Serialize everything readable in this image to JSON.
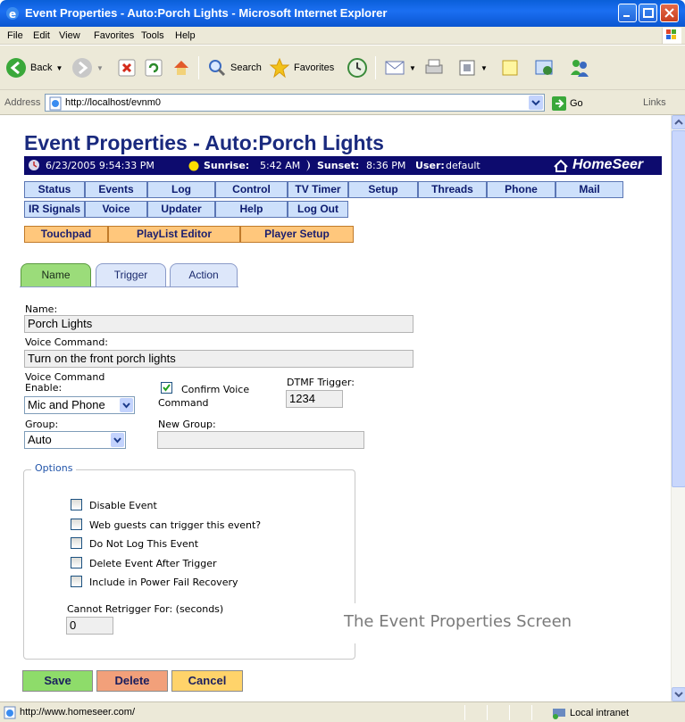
{
  "window": {
    "title": "Event Properties - Auto:Porch Lights - Microsoft Internet Explorer"
  },
  "menu": [
    "File",
    "Edit",
    "View",
    "Favorites",
    "Tools",
    "Help"
  ],
  "toolbar": {
    "back_label": "Back",
    "search_label": "Search",
    "favorites_label": "Favorites"
  },
  "address": {
    "label": "Address",
    "url": "http://localhost/evnm0",
    "go_label": "Go",
    "links_label": "Links"
  },
  "page": {
    "title": "Event Properties - Auto:Porch Lights",
    "datetime": "6/23/2005 9:54:33 PM",
    "sunrise_label": "Sunrise:",
    "sunrise": "5:42 AM",
    "sunset_label": "Sunset:",
    "sunset": "8:36 PM",
    "user_label": "User:",
    "user": "default",
    "brand": "HomeSeer"
  },
  "nav": {
    "row1": [
      "Status",
      "Events",
      "Log",
      "Control",
      "TV Timer",
      "Setup",
      "Threads",
      "Phone",
      "Mail"
    ],
    "row2": [
      "IR Signals",
      "Voice",
      "Updater",
      "Help",
      "Log Out"
    ],
    "row3": [
      "Touchpad",
      "PlayList Editor",
      "Player Setup"
    ]
  },
  "tabs": [
    "Name",
    "Trigger",
    "Action"
  ],
  "form": {
    "name_label": "Name:",
    "name_value": "Porch Lights",
    "voice_label": "Voice Command:",
    "voice_value": "Turn on the front porch lights",
    "voice_enable_label_1": "Voice Command",
    "voice_enable_label_2": "Enable:",
    "voice_enable_value": "Mic and Phone",
    "confirm_label_1": "Confirm Voice",
    "confirm_label_2": "Command",
    "dtmf_label": "DTMF Trigger:",
    "dtmf_value": "1234",
    "group_label": "Group:",
    "group_value": "Auto",
    "new_group_label": "New Group:",
    "new_group_value": ""
  },
  "options": {
    "legend": "Options",
    "items": [
      "Disable Event",
      "Web guests can trigger this event?",
      "Do Not Log This Event",
      "Delete Event After Trigger",
      "Include in Power Fail Recovery"
    ],
    "retrigger_label": "Cannot Retrigger For: (seconds)",
    "retrigger_value": "0"
  },
  "caption": "The Event Properties Screen",
  "actions": {
    "save": "Save",
    "delete": "Delete",
    "cancel": "Cancel"
  },
  "status": {
    "url": "http://www.homeseer.com/",
    "zone": "Local intranet"
  },
  "colors": {
    "title_blue": "#1a2a7e",
    "infobar_navy": "#0d0b6e",
    "nav_blue": "#cde0fb",
    "nav_orange": "#ffc77c",
    "tab_green": "#9bdc7a",
    "save_green": "#8edc6a",
    "delete_salmon": "#f2a07a",
    "cancel_yellow": "#ffd36a"
  }
}
